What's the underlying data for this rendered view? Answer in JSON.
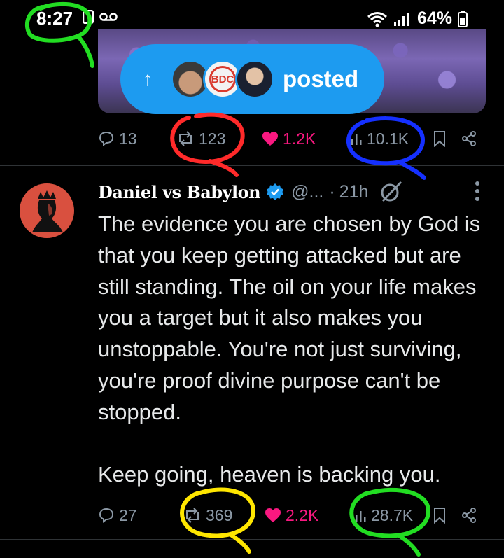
{
  "status_bar": {
    "time": "8:27",
    "battery": "64%",
    "icons": [
      "image-icon",
      "voicemail-icon",
      "wifi-icon",
      "signal-icon",
      "battery-icon"
    ]
  },
  "repost_banner": {
    "label": "posted",
    "avatar_badge_text": "BDC",
    "color": "#1d9bf0"
  },
  "prev_tweet": {
    "replies": "13",
    "reposts": "123",
    "likes": "1.2K",
    "views": "10.1K"
  },
  "tweet": {
    "display_name": "Daniel vs Babylon",
    "handle": "@...",
    "separator": "·",
    "time": "21h",
    "body": "The evidence you are chosen by God is that you keep getting attacked but are still standing. The oil on your life makes you a target but it also makes you unstoppable. You're not just surviving, you're proof divine purpose can't be stopped.\n\nKeep going, heaven is backing you.",
    "replies": "27",
    "reposts": "369",
    "likes": "2.2K",
    "views": "28.7K"
  },
  "colors": {
    "background": "#000000",
    "accent": "#1d9bf0",
    "like": "#f91880",
    "muted": "#8b98a5",
    "annotation_green": "#22dd22",
    "annotation_red": "#ff2a2a",
    "annotation_blue": "#1530ff",
    "annotation_yellow": "#ffe600"
  }
}
